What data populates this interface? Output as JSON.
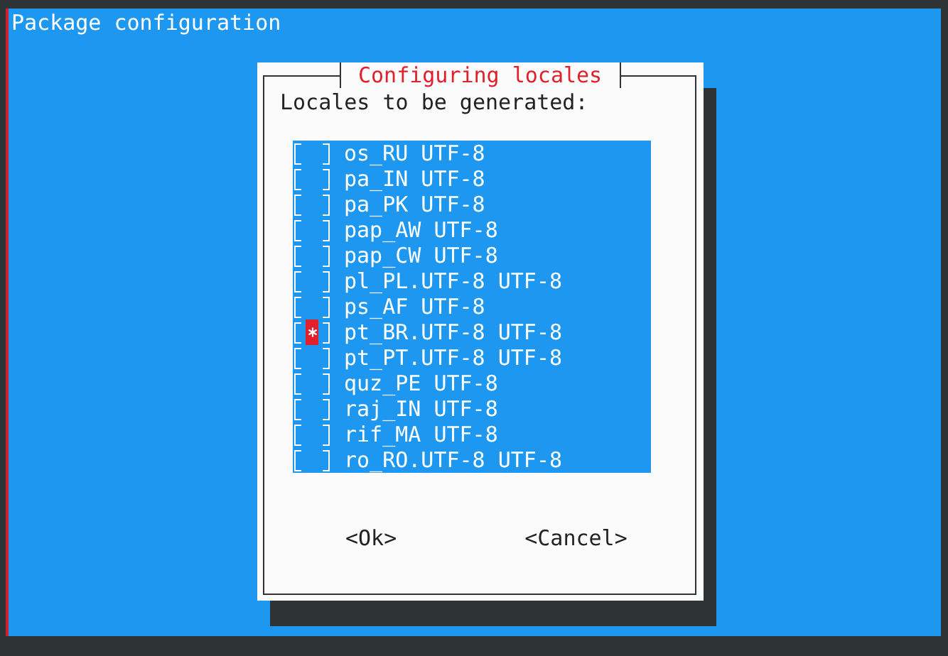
{
  "screen": {
    "title": "Package configuration"
  },
  "dialog": {
    "title": "Configuring locales",
    "prompt": "Locales to be generated:",
    "items": [
      {
        "label": "os_RU UTF-8",
        "checked": false,
        "selected": false
      },
      {
        "label": "pa_IN UTF-8",
        "checked": false,
        "selected": false
      },
      {
        "label": "pa_PK UTF-8",
        "checked": false,
        "selected": false
      },
      {
        "label": "pap_AW UTF-8",
        "checked": false,
        "selected": false
      },
      {
        "label": "pap_CW UTF-8",
        "checked": false,
        "selected": false
      },
      {
        "label": "pl_PL.UTF-8 UTF-8",
        "checked": false,
        "selected": false
      },
      {
        "label": "ps_AF UTF-8",
        "checked": false,
        "selected": false
      },
      {
        "label": "pt_BR.UTF-8 UTF-8",
        "checked": true,
        "selected": true
      },
      {
        "label": "pt_PT.UTF-8 UTF-8",
        "checked": false,
        "selected": false
      },
      {
        "label": "quz_PE UTF-8",
        "checked": false,
        "selected": false
      },
      {
        "label": "raj_IN UTF-8",
        "checked": false,
        "selected": false
      },
      {
        "label": "rif_MA UTF-8",
        "checked": false,
        "selected": false
      },
      {
        "label": "ro_RO.UTF-8 UTF-8",
        "checked": false,
        "selected": false
      }
    ],
    "buttons": [
      {
        "label": "<Ok>",
        "kind": "ok"
      },
      {
        "label": "<Cancel>",
        "kind": "cancel"
      }
    ]
  }
}
